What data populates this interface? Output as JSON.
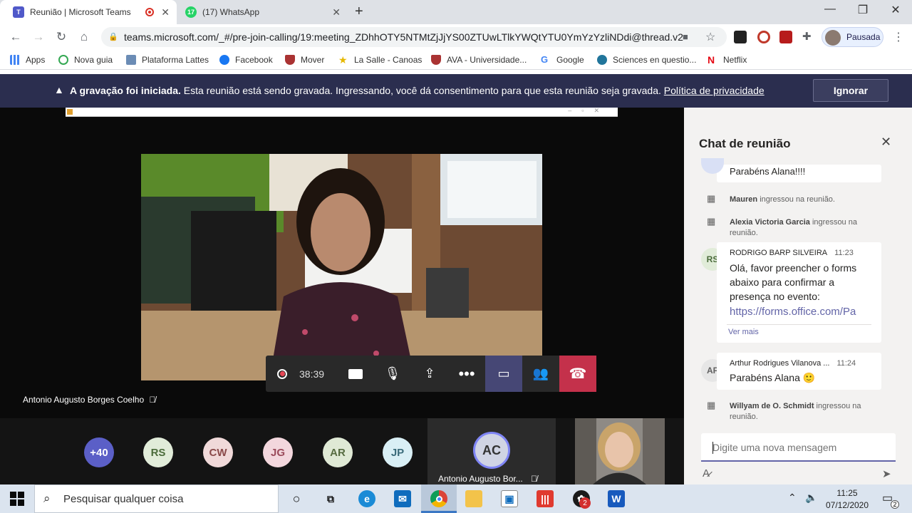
{
  "browser": {
    "tabs": [
      {
        "title": "Reunião | Microsoft Teams",
        "icon": "teams-icon",
        "recording": true
      },
      {
        "title": "(17) WhatsApp",
        "icon": "whatsapp-icon",
        "badge": "17"
      }
    ],
    "url": "teams.microsoft.com/_#/pre-join-calling/19:meeting_ZDhhOTY5NTMtZjJjYS00ZTUwLTlkYWQtYTU0YmYzYzliNDdi@thread.v2",
    "profile_label": "Pausada",
    "bookmarks": [
      {
        "label": "Apps",
        "icon": "apps-grid-icon"
      },
      {
        "label": "Nova guia",
        "icon": "new-tab-icon"
      },
      {
        "label": "Plataforma Lattes",
        "icon": "lattes-icon"
      },
      {
        "label": "Facebook",
        "icon": "facebook-icon"
      },
      {
        "label": "Mover",
        "icon": "shield-icon"
      },
      {
        "label": "La Salle - Canoas",
        "icon": "star-icon"
      },
      {
        "label": "AVA - Universidade...",
        "icon": "shield-icon"
      },
      {
        "label": "Google",
        "icon": "google-icon"
      },
      {
        "label": "Sciences en questio...",
        "icon": "wordpress-icon"
      },
      {
        "label": "Netflix",
        "icon": "netflix-icon"
      }
    ]
  },
  "banner": {
    "bold": "A gravação foi iniciada.",
    "text": "Esta reunião está sendo gravada. Ingressando, você dá consentimento para que esta reunião seja gravada.",
    "link": "Política de privacidade",
    "button": "Ignorar"
  },
  "meeting": {
    "speaker_name": "Antonio Augusto Borges Coelho",
    "timer": "38:39",
    "participants": [
      {
        "initials": "+40",
        "bg": "#5b5fc7",
        "fg": "#ffffff"
      },
      {
        "initials": "RS",
        "bg": "#e1ecd9",
        "fg": "#4a6b3a"
      },
      {
        "initials": "CW",
        "bg": "#f0d9d9",
        "fg": "#8a4a4a"
      },
      {
        "initials": "JG",
        "bg": "#f3d7dd",
        "fg": "#9a4a5a"
      },
      {
        "initials": "AR",
        "bg": "#dfe9d5",
        "fg": "#566b40"
      },
      {
        "initials": "JP",
        "bg": "#d9eff5",
        "fg": "#3a6b7a"
      }
    ],
    "self": {
      "initials": "AC",
      "name": "Antonio Augusto Bor..."
    }
  },
  "chat": {
    "title": "Chat de reunião",
    "messages": [
      {
        "kind": "msg_partial",
        "text": "Parabéns Alana!!!!"
      },
      {
        "kind": "system",
        "who": "Mauren",
        "text": "ingressou na reunião."
      },
      {
        "kind": "system",
        "who": "Alexia Victoria Garcia",
        "text": "ingressou na",
        "text2": "reunião."
      },
      {
        "kind": "msg",
        "initials": "RS",
        "author": "RODRIGO BARP SILVEIRA",
        "time": "11:23",
        "lines": [
          "Olá, favor preencher o forms",
          "abaixo para confirmar a",
          "presença no evento:"
        ],
        "link": "https://forms.office.com/Pa",
        "more": "Ver mais"
      },
      {
        "kind": "msg",
        "initials": "AF",
        "author": "Arthur Rodrigues Vilanova ...",
        "time": "11:24",
        "lines": [
          "Parabéns Alana 🙂"
        ]
      },
      {
        "kind": "system",
        "who": "Willyam de O. Schmidt",
        "text": "ingressou na",
        "text2": "reunião."
      }
    ],
    "composer_placeholder": "Digite uma nova mensagem"
  },
  "taskbar": {
    "search_placeholder": "Pesquisar qualquer coisa",
    "time": "11:25",
    "date": "07/12/2020",
    "notification_count": "2",
    "app_badge": "2"
  }
}
